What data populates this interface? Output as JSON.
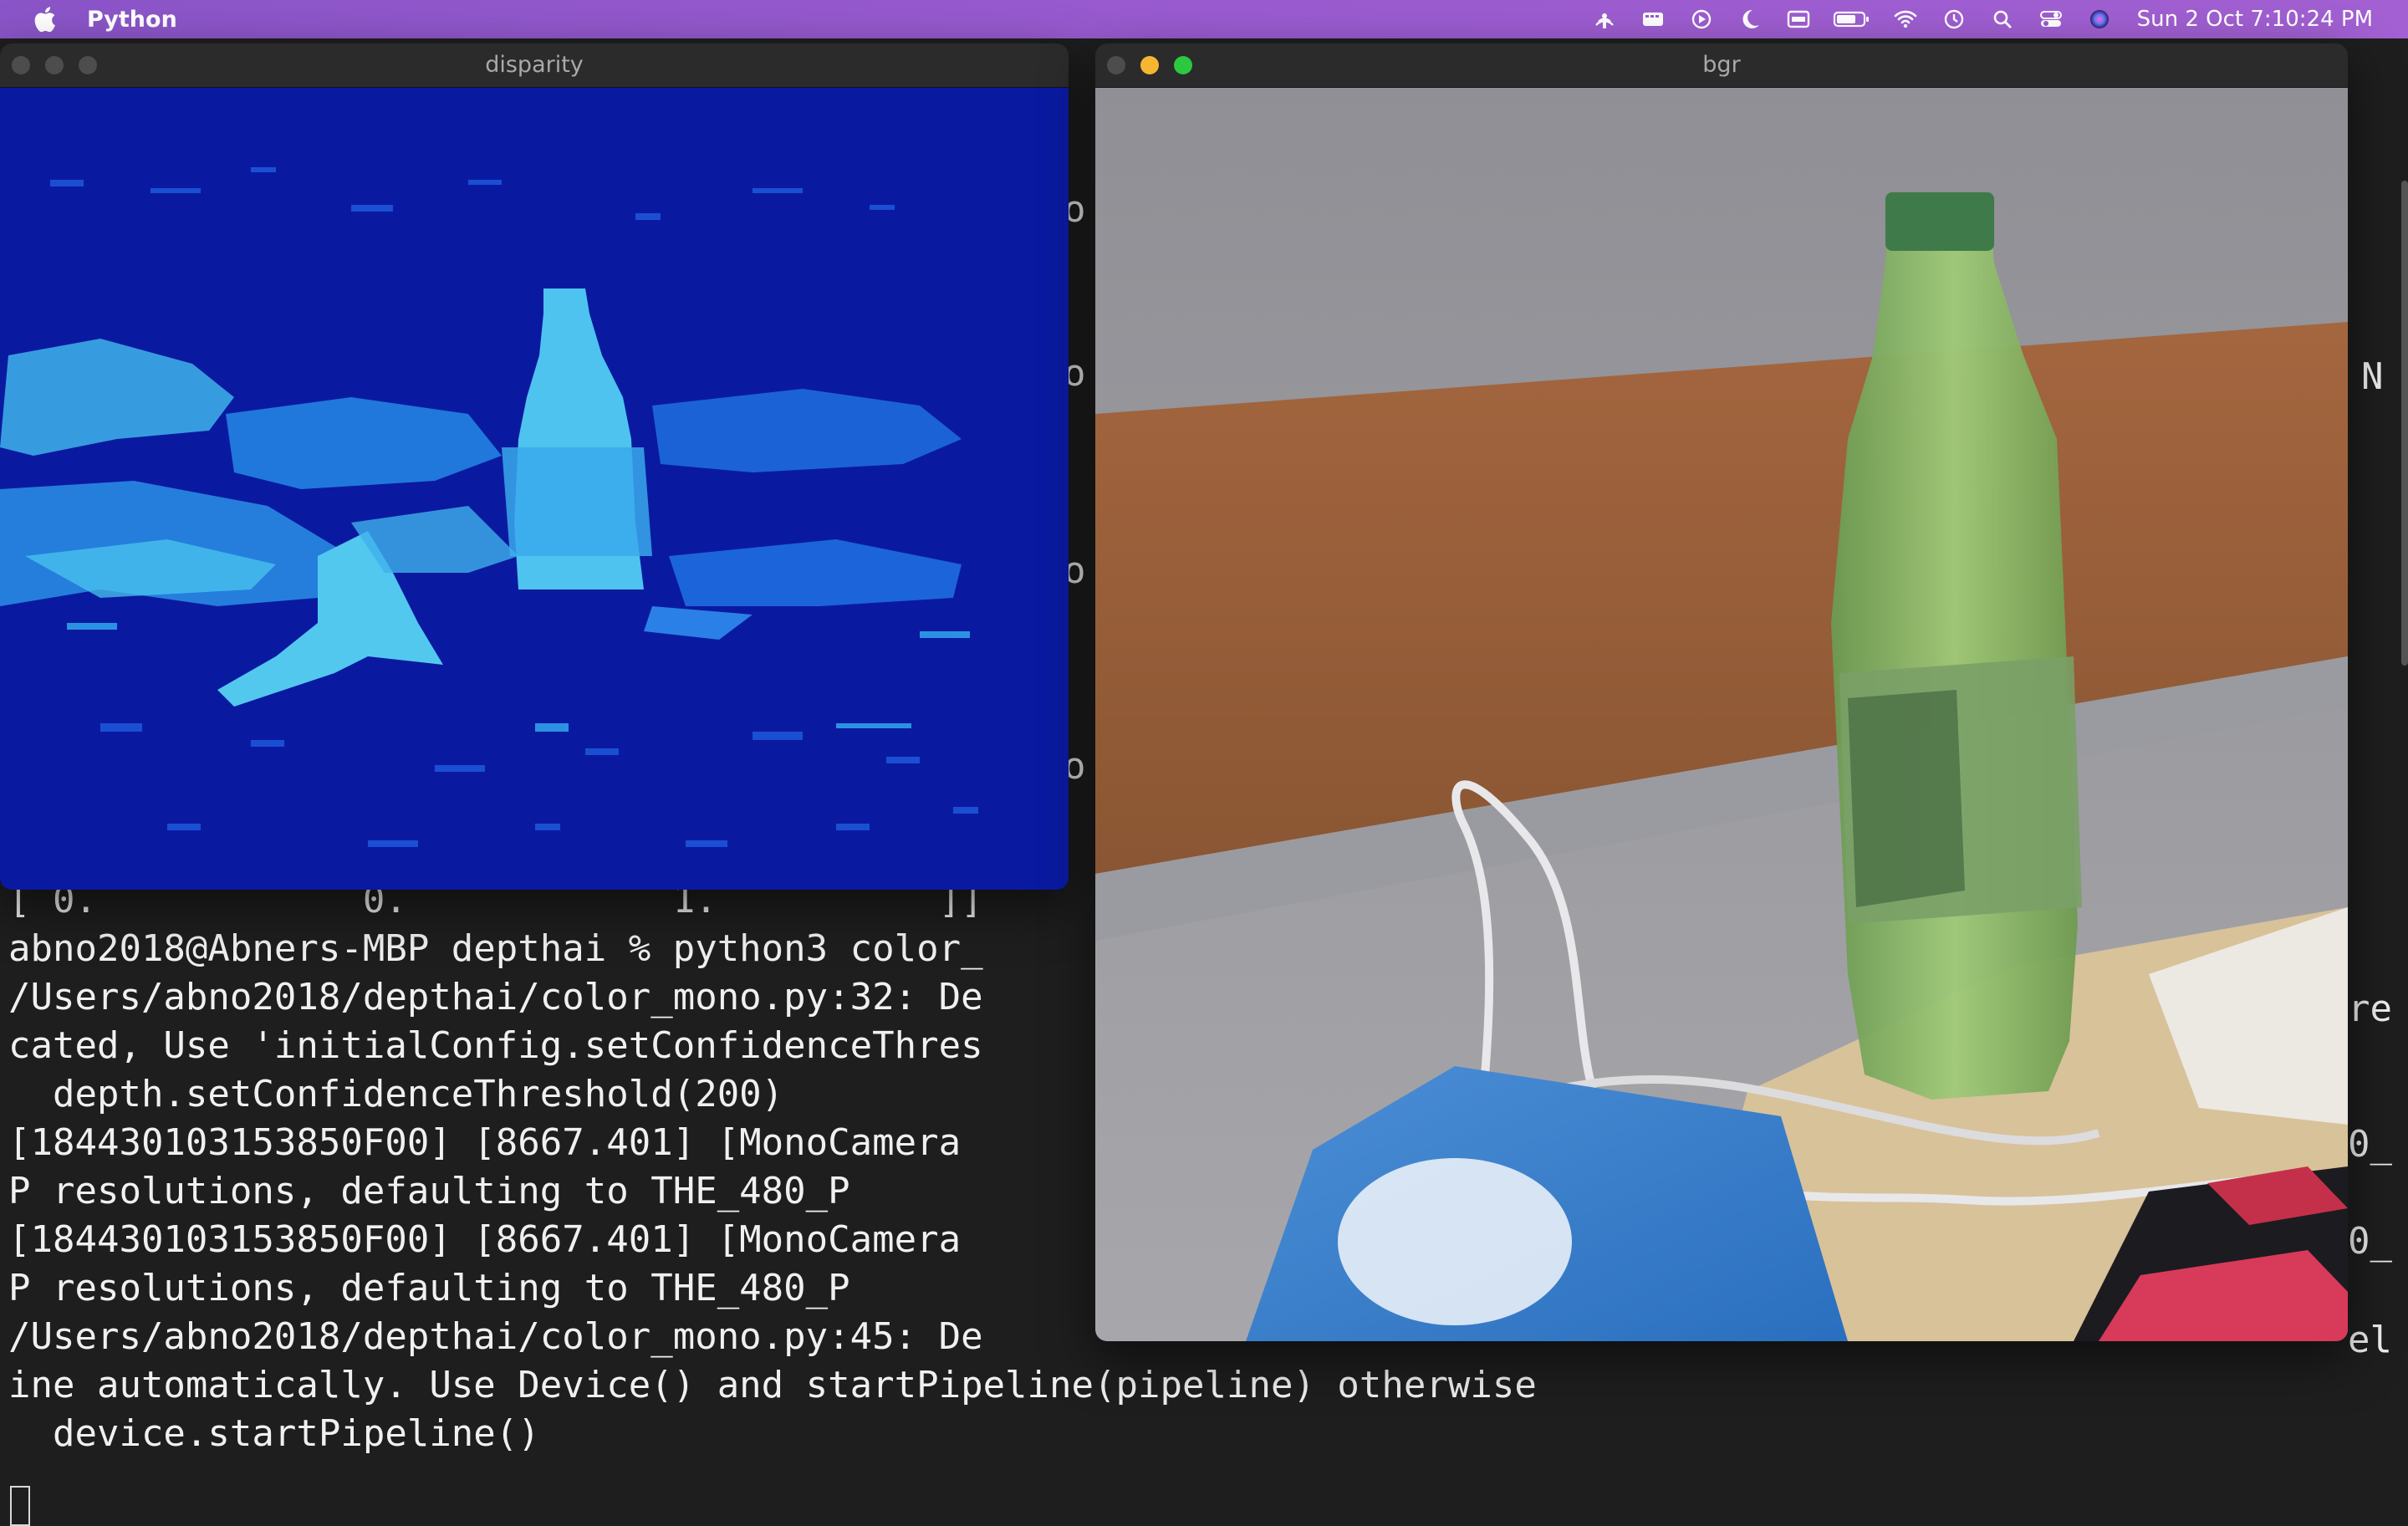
{
  "menubar": {
    "app_name": "Python",
    "clock": "Sun 2 Oct  7:10:24 PM",
    "icons": [
      "airdrop-icon",
      "video-icon",
      "play-icon",
      "moon-icon",
      "display-icon",
      "battery-icon",
      "wifi-icon",
      "time-machine-icon",
      "search-icon",
      "control-center-icon",
      "siri-icon"
    ]
  },
  "windows": {
    "disparity": {
      "title": "disparity",
      "content": "depth disparity map of a bottle on a desk"
    },
    "bgr": {
      "title": "bgr",
      "content": "color camera view of a green plastic bottle, white cable and a blue snack bag on a desk"
    }
  },
  "terminal": {
    "lines": [
      "[ 0.            0.            1.          ]]",
      "abno2018@Abners-MBP depthai % python3 color_",
      "/Users/abno2018/depthai/color_mono.py:32: De",
      "cated, Use 'initialConfig.setConfidenceThres",
      "  depth.setConfidenceThreshold(200)",
      "[184430103153850F00] [8667.401] [MonoCamera",
      "P resolutions, defaulting to THE_480_P",
      "[184430103153850F00] [8667.401] [MonoCamera",
      "P resolutions, defaulting to THE_480_P",
      "/Users/abno2018/depthai/color_mono.py:45: De",
      "ine automatically. Use Device() and startPipeline(pipeline) otherwise",
      "  device.startPipeline()"
    ],
    "right_fragments": {
      "re": "re",
      "zero_a": "0_",
      "zero_b": "0_",
      "el": "el",
      "n": "N"
    },
    "left_fragments": [
      "o",
      "o",
      "o",
      "o"
    ]
  }
}
